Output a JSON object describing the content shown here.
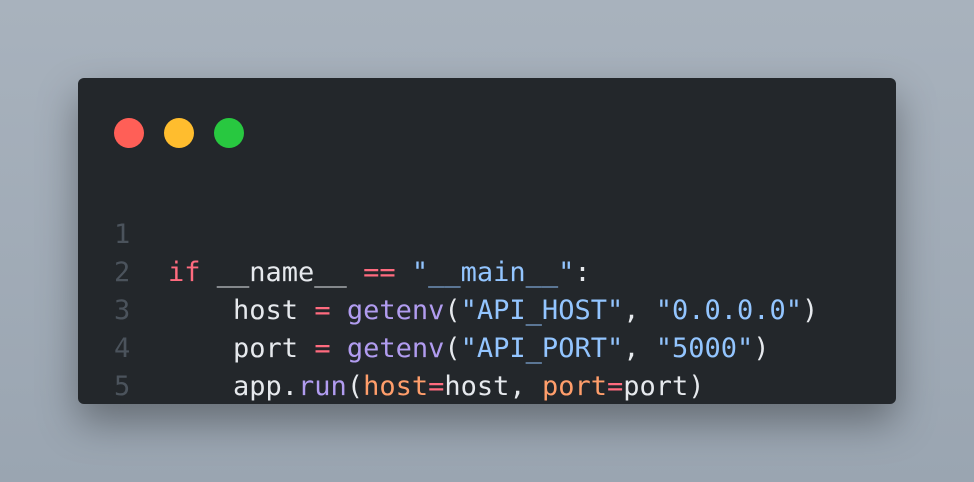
{
  "window": {
    "controls": [
      {
        "name": "close",
        "color": "#ff5f57"
      },
      {
        "name": "minimize",
        "color": "#ffbd2e"
      },
      {
        "name": "maximize",
        "color": "#28c840"
      }
    ]
  },
  "colors": {
    "keyword": "#ff6b7f",
    "function": "#b19cf0",
    "string": "#93c5ff",
    "param": "#ff9e6b",
    "default": "#e6e9ed",
    "line_number": "#4b535c"
  },
  "code": {
    "lines": [
      {
        "number": "1",
        "tokens": [
          {
            "t": "if",
            "k": "keyword"
          },
          {
            "t": " __name__ ",
            "k": "default"
          },
          {
            "t": "==",
            "k": "keyword"
          },
          {
            "t": " ",
            "k": "default"
          },
          {
            "t": "\"__main__\"",
            "k": "string"
          },
          {
            "t": ":",
            "k": "default"
          }
        ]
      },
      {
        "number": "2",
        "tokens": [
          {
            "t": "    host ",
            "k": "default"
          },
          {
            "t": "=",
            "k": "keyword"
          },
          {
            "t": " ",
            "k": "default"
          },
          {
            "t": "getenv",
            "k": "function"
          },
          {
            "t": "(",
            "k": "default"
          },
          {
            "t": "\"API_HOST\"",
            "k": "string"
          },
          {
            "t": ", ",
            "k": "default"
          },
          {
            "t": "\"0.0.0.0\"",
            "k": "string"
          },
          {
            "t": ")",
            "k": "default"
          }
        ]
      },
      {
        "number": "3",
        "tokens": [
          {
            "t": "    port ",
            "k": "default"
          },
          {
            "t": "=",
            "k": "keyword"
          },
          {
            "t": " ",
            "k": "default"
          },
          {
            "t": "getenv",
            "k": "function"
          },
          {
            "t": "(",
            "k": "default"
          },
          {
            "t": "\"API_PORT\"",
            "k": "string"
          },
          {
            "t": ", ",
            "k": "default"
          },
          {
            "t": "\"5000\"",
            "k": "string"
          },
          {
            "t": ")",
            "k": "default"
          }
        ]
      },
      {
        "number": "4",
        "tokens": [
          {
            "t": "    app.",
            "k": "default"
          },
          {
            "t": "run",
            "k": "function"
          },
          {
            "t": "(",
            "k": "default"
          },
          {
            "t": "host",
            "k": "param"
          },
          {
            "t": "=",
            "k": "keyword"
          },
          {
            "t": "host, ",
            "k": "default"
          },
          {
            "t": "port",
            "k": "param"
          },
          {
            "t": "=",
            "k": "keyword"
          },
          {
            "t": "port)",
            "k": "default"
          }
        ]
      },
      {
        "number": "5",
        "tokens": []
      }
    ]
  }
}
